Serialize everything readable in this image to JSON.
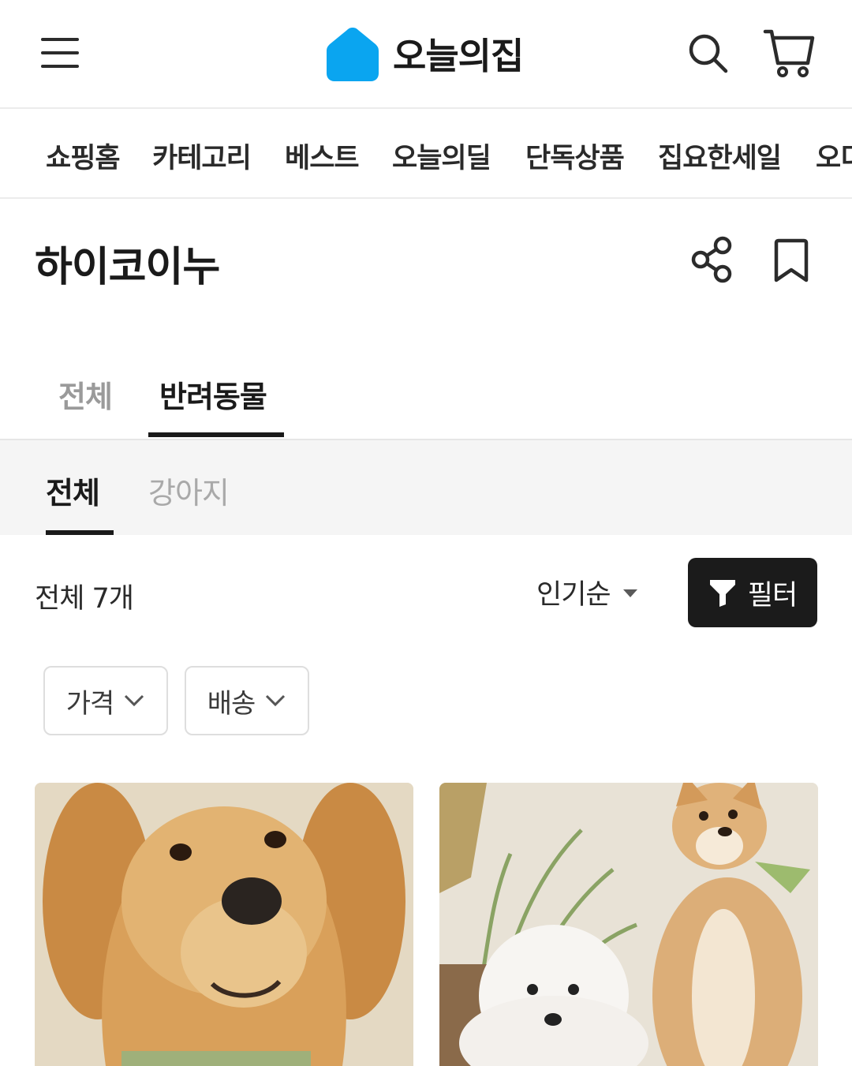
{
  "header": {
    "logo_text": "오늘의집",
    "brand_color": "#35C5F0"
  },
  "category_nav": {
    "items": [
      "쇼핑홈",
      "카테고리",
      "베스트",
      "오늘의딜",
      "단독상품",
      "집요한세일",
      "오디"
    ]
  },
  "page": {
    "title": "하이코이누"
  },
  "tabs": {
    "items": [
      "전체",
      "반려동물"
    ],
    "selected": "반려동물"
  },
  "sub_tabs": {
    "items": [
      "전체",
      "강아지"
    ],
    "selected": "전체"
  },
  "list_controls": {
    "count_text": "전체 7개",
    "sort_label": "인기순",
    "filter_label": "필터"
  },
  "chips": {
    "price_label": "가격",
    "shipping_label": "배송"
  },
  "products": [
    {
      "image": "golden-retriever-photo"
    },
    {
      "image": "bichon-and-shiba-photo"
    }
  ]
}
